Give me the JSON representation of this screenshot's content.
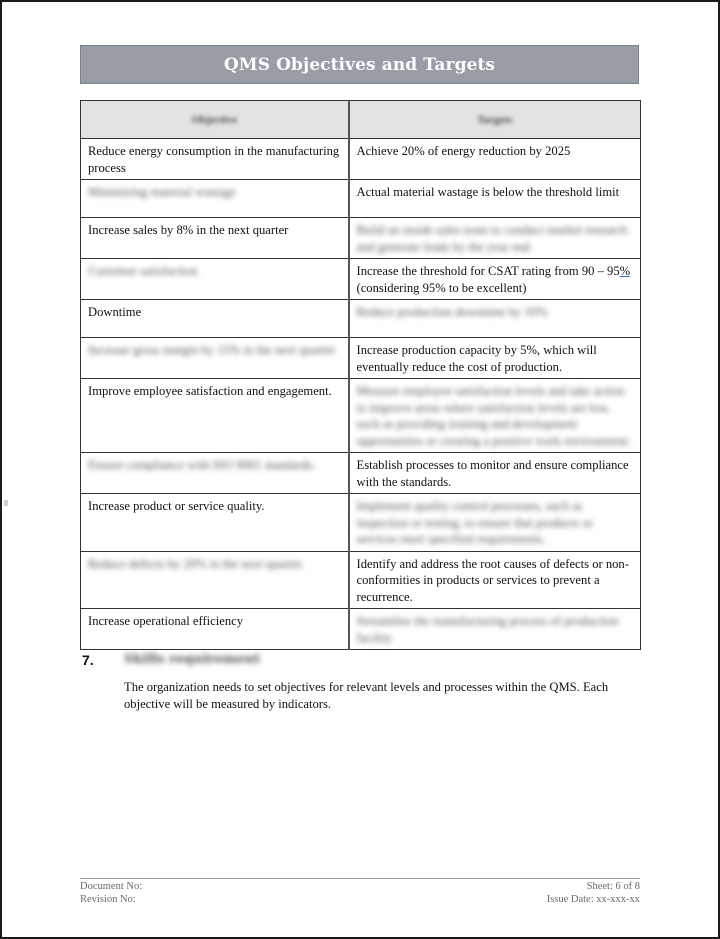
{
  "document": {
    "title": "QMS Objectives and Targets"
  },
  "table": {
    "headers": [
      "Objective",
      "Targets"
    ],
    "rows": [
      {
        "objective": "Reduce energy consumption in the manufacturing process",
        "objective_blurred": false,
        "target": "Achieve 20% of energy reduction by 2025",
        "target_blurred": false
      },
      {
        "objective": "Minimizing material wastage",
        "objective_blurred": true,
        "target": "Actual material wastage is below the threshold limit",
        "target_blurred": false
      },
      {
        "objective": "Increase sales by 8% in the next quarter",
        "objective_blurred": false,
        "target": "Build an inside sales team to conduct market research and generate leads by the year end",
        "target_blurred": true
      },
      {
        "objective": "Customer satisfaction",
        "objective_blurred": true,
        "target_pre": "Increase the threshold for CSAT rating from 90 – 95",
        "target_link": "%",
        "target_post": "(considering 95% to be excellent)",
        "target_blurred": false
      },
      {
        "objective": "Downtime",
        "objective_blurred": false,
        "target": "Reduce production downtime by 10%",
        "target_blurred": true
      },
      {
        "objective": "Increase gross margin by 15% in the next quarter",
        "objective_blurred": true,
        "target": "Increase production capacity by 5%, which will eventually reduce the cost of production.",
        "target_blurred": false
      },
      {
        "objective": "Improve employee satisfaction and engagement.",
        "objective_blurred": false,
        "target": "Measure employee satisfaction levels and take action to improve areas where satisfaction levels are low, such as providing training and development opportunities or creating a positive work environment.",
        "target_blurred": true
      },
      {
        "objective": "Ensure compliance with ISO 9001 standards.",
        "objective_blurred": true,
        "target": "Establish processes to monitor and ensure compliance with the standards.",
        "target_blurred": false
      },
      {
        "objective": "Increase product or service quality.",
        "objective_blurred": false,
        "target": "Implement quality control processes, such as inspection or testing, to ensure that products or services meet specified requirements.",
        "target_blurred": true
      },
      {
        "objective": "Reduce defects by 20% in the next quarter.",
        "objective_blurred": true,
        "target": "Identify and address the root causes of defects or non-conformities in products or services to prevent a recurrence.",
        "target_blurred": false
      },
      {
        "objective": "Increase operational efficiency",
        "objective_blurred": false,
        "target": "Streamline the manufacturing process of production facility",
        "target_blurred": true
      }
    ]
  },
  "section": {
    "number": "7.",
    "title": "Skills requirement",
    "body": "The organization needs to set objectives for relevant levels and processes within the QMS. Each objective will be measured by indicators."
  },
  "footer": {
    "document_no_label": "Document No:",
    "revision_no_label": "Revision No:",
    "sheet": "Sheet: 6 of 8",
    "issue_date": "Issue Date: xx-xxx-xx"
  }
}
